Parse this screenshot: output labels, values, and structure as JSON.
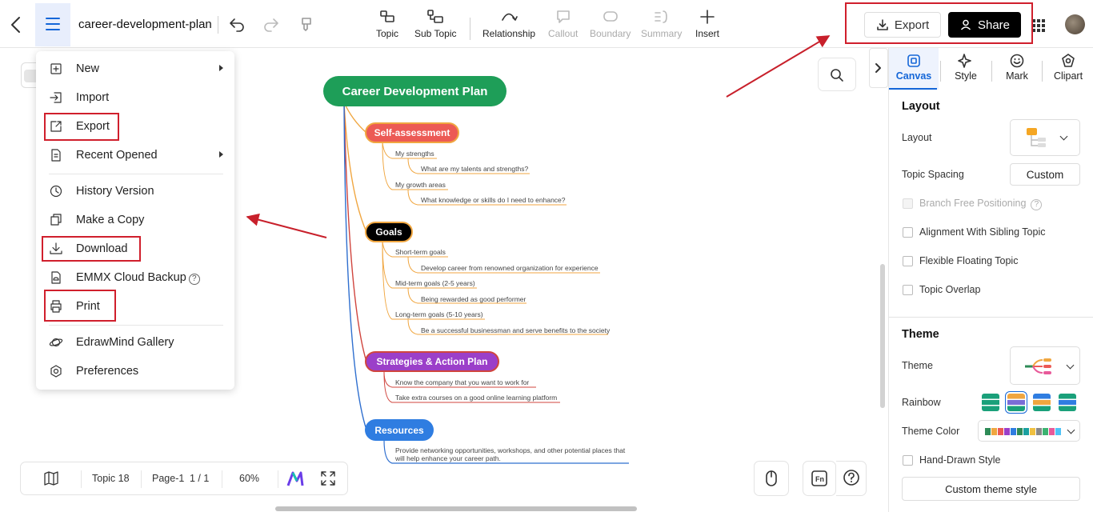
{
  "topbar": {
    "doc_title": "career-development-plan",
    "tools": [
      {
        "label": "Topic",
        "icon": "topic-icon",
        "disabled": false
      },
      {
        "label": "Sub Topic",
        "icon": "sub-topic-icon",
        "disabled": false
      },
      {
        "label": "Relationship",
        "icon": "relationship-icon",
        "disabled": false
      },
      {
        "label": "Callout",
        "icon": "callout-icon",
        "disabled": true
      },
      {
        "label": "Boundary",
        "icon": "boundary-icon",
        "disabled": true
      },
      {
        "label": "Summary",
        "icon": "summary-icon",
        "disabled": true
      },
      {
        "label": "Insert",
        "icon": "plus-icon",
        "disabled": false
      }
    ],
    "export_label": "Export",
    "share_label": "Share"
  },
  "menu": {
    "items": [
      {
        "label": "New",
        "icon": "new-file-icon",
        "submenu": true
      },
      {
        "label": "Import",
        "icon": "import-icon",
        "submenu": false
      },
      {
        "label": "Export",
        "icon": "export-icon",
        "submenu": false,
        "highlighted": true
      },
      {
        "label": "Recent Opened",
        "icon": "recent-file-icon",
        "submenu": true
      },
      {
        "label": "History Version",
        "icon": "history-icon",
        "submenu": false
      },
      {
        "label": "Make a Copy",
        "icon": "copy-icon",
        "submenu": false
      },
      {
        "label": "Download",
        "icon": "download-icon",
        "submenu": false,
        "highlighted": true
      },
      {
        "label": "EMMX Cloud Backup",
        "icon": "cloud-backup-icon",
        "submenu": false,
        "help": "?"
      },
      {
        "label": "Print",
        "icon": "print-icon",
        "submenu": false,
        "highlighted": true
      },
      {
        "label": "EdrawMind Gallery",
        "icon": "gallery-icon",
        "submenu": false
      },
      {
        "label": "Preferences",
        "icon": "settings-icon",
        "submenu": false
      }
    ]
  },
  "mindmap": {
    "root": "Career Development Plan",
    "branches": [
      {
        "label": "Self-assessment",
        "color": "#ec5a55",
        "line": "#f0a640",
        "leaves": [
          "My strengths",
          "What are my talents and strengths?",
          "My growth areas",
          "What knowledge or skills do I need to enhance?"
        ]
      },
      {
        "label": "Goals",
        "color": "#000000",
        "line": "#f0a640",
        "leaves": [
          "Short-term goals",
          "Develop career from renowned organization for experience",
          "Mid-term goals (2-5 years)",
          "Being rewarded as good performer",
          "Long-term goals (5-10 years)",
          "Be a successful businessman and serve benefits to the society"
        ]
      },
      {
        "label": "Strategies & Action Plan",
        "color": "#9b3fc9",
        "line": "#d0453e",
        "leaves": [
          "Know the company that you want to work for",
          "Take extra courses on a good online learning platform"
        ]
      },
      {
        "label": "Resources",
        "color": "#2f7de1",
        "line": "#2f6fcf",
        "leaves": [
          "Provide networking opportunities, workshops, and other potential places that",
          "will help enhance your career path."
        ]
      }
    ]
  },
  "right_panel": {
    "tabs": [
      "Canvas",
      "Style",
      "Mark",
      "Clipart"
    ],
    "active_tab": "Canvas",
    "layout_title": "Layout",
    "layout_label": "Layout",
    "topic_spacing_label": "Topic Spacing",
    "topic_spacing_value": "Custom",
    "checkboxes": [
      {
        "label": "Branch Free Positioning",
        "disabled": true,
        "help": "?"
      },
      {
        "label": "Alignment With Sibling Topic",
        "disabled": false
      },
      {
        "label": "Flexible Floating Topic",
        "disabled": false
      },
      {
        "label": "Topic Overlap",
        "disabled": false
      }
    ],
    "theme_title": "Theme",
    "theme_label": "Theme",
    "rainbow_label": "Rainbow",
    "theme_color_label": "Theme Color",
    "theme_colors": [
      "#2e8b57",
      "#f0a640",
      "#ec5a55",
      "#9b3fc9",
      "#2f7de1",
      "#2e8b57",
      "#1aa0a0",
      "#f0c040",
      "#888888",
      "#3cb371",
      "#e85a9a",
      "#4fc3f7"
    ],
    "hand_drawn_label": "Hand-Drawn Style",
    "custom_theme_label": "Custom theme style"
  },
  "bottom_bar": {
    "topic_count": "Topic 18",
    "page": "Page-1",
    "page_count": "1 / 1",
    "zoom": "60%"
  },
  "colors": {
    "accent": "#1466d8",
    "annotation_red": "#d01f2c",
    "root_green": "#1e9e58"
  }
}
